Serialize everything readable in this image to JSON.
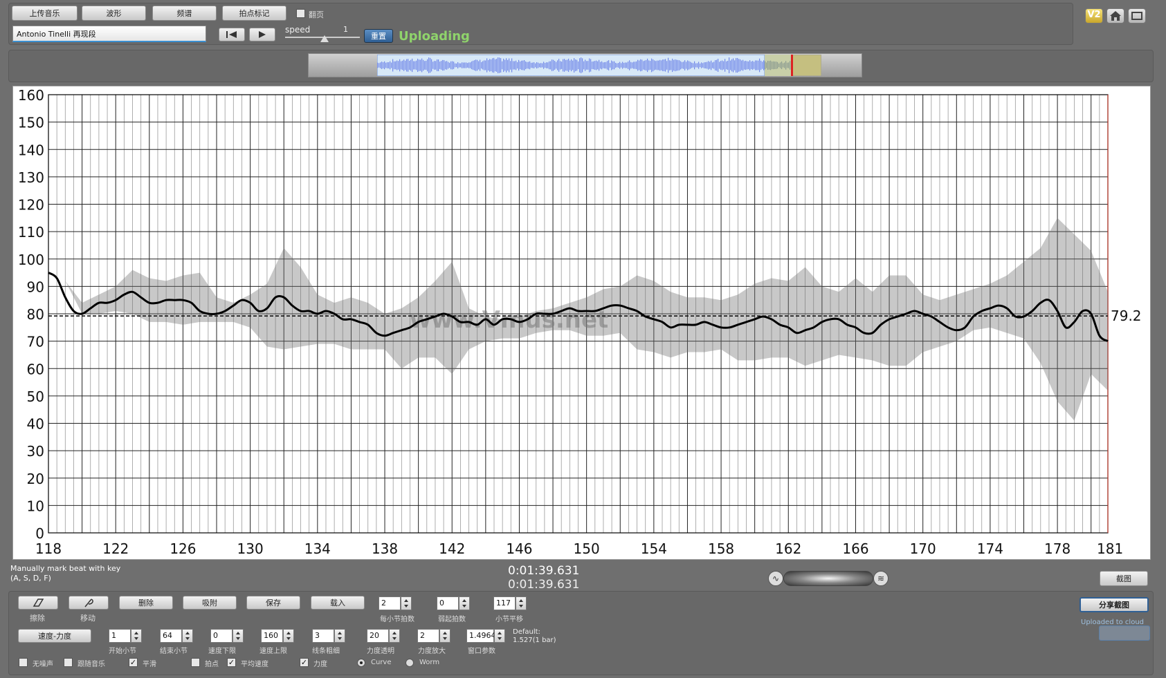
{
  "toolbar": {
    "upload_label": "上传音乐",
    "waveform_label": "波形",
    "spectrum_label": "频谱",
    "beat_mark_label": "拍点标记",
    "flip_label": "翻页",
    "track_name": "Antonio Tinelli 再现段",
    "speed_label": "speed",
    "speed_value": "1",
    "reset_label": "重置",
    "upload_status": "Uploading"
  },
  "top_right_icons": [
    "v2-icon",
    "home-icon",
    "window-icon"
  ],
  "top_right": {
    "v2_label": "V2"
  },
  "watermark": "www.Vmus.net",
  "status": {
    "hint_line1": "Manually mark beat with key",
    "hint_line2": "(A, S, D, F)",
    "time_1": "0:01:39.631",
    "time_2": "0:01:39.631",
    "screenshot_label": "截图"
  },
  "controls": {
    "erase_label": "擦除",
    "move_label": "移动",
    "delete_label": "删除",
    "snap_label": "吸附",
    "save_label": "保存",
    "load_label": "载入",
    "beats_per_bar_value": "2",
    "beats_per_bar_label": "每小节拍数",
    "start_beat_value": "0",
    "start_beat_label": "弱起拍数",
    "bar_shift_value": "117",
    "bar_shift_label": "小节平移",
    "mode_label": "速度-力度",
    "start_bar_value": "1",
    "start_bar_label": "开始小节",
    "end_bar_value": "64",
    "end_bar_label": "结束小节",
    "tempo_low_value": "0",
    "tempo_low_label": "速度下限",
    "tempo_high_value": "160",
    "tempo_high_label": "速度上限",
    "line_width_value": "3",
    "line_width_label": "线条粗细",
    "dyn_alpha_value": "20",
    "dyn_alpha_label": "力度透明",
    "dyn_zoom_value": "2",
    "dyn_zoom_label": "力度放大",
    "window_value": "1.4964",
    "window_label": "窗口参数",
    "default_line1": "Default:",
    "default_line2": "1.527(1 bar)",
    "share_label": "分享截图",
    "uploaded_label": "Uploaded to cloud",
    "cb_no_noise": "无噪声",
    "cb_follow_music": "跟随音乐",
    "cb_smooth": "平滑",
    "cb_beat": "拍点",
    "cb_avg_tempo": "平均速度",
    "cb_dynamics": "力度",
    "radio_curve": "Curve",
    "radio_worm": "Worm"
  },
  "chart_data": {
    "type": "line",
    "xlim": [
      118,
      181
    ],
    "ylim": [
      0,
      160
    ],
    "x_ticks": [
      118,
      122,
      126,
      130,
      134,
      138,
      142,
      146,
      150,
      154,
      158,
      162,
      166,
      170,
      174,
      178,
      181
    ],
    "y_ticks": [
      0,
      10,
      20,
      30,
      40,
      50,
      60,
      70,
      80,
      90,
      100,
      110,
      120,
      130,
      140,
      150,
      160
    ],
    "average": 79.2,
    "average_label": "79.2",
    "grid": true,
    "series": [
      {
        "x": [
          118,
          118.5,
          119,
          119.5,
          120,
          120.5,
          121,
          121.5,
          122,
          122.5,
          123,
          123.5,
          124,
          124.5,
          125,
          125.5,
          126,
          126.5,
          127,
          127.5,
          128,
          128.5,
          129,
          129.5,
          130,
          130.5,
          131,
          131.5,
          132,
          132.5,
          133,
          133.5,
          134,
          134.5,
          135,
          135.5,
          136,
          136.5,
          137,
          137.5,
          138,
          138.5,
          139,
          139.5,
          140,
          140.5,
          141,
          141.5,
          142,
          142.5,
          143,
          143.5,
          144,
          144.5,
          145,
          145.5,
          146,
          146.5,
          147,
          147.5,
          148,
          148.5,
          149,
          149.5,
          150,
          150.5,
          151,
          151.5,
          152,
          152.5,
          153,
          153.5,
          154,
          154.5,
          155,
          155.5,
          156,
          156.5,
          157,
          157.5,
          158,
          158.5,
          159,
          159.5,
          160,
          160.5,
          161,
          161.5,
          162,
          162.5,
          163,
          163.5,
          164,
          164.5,
          165,
          165.5,
          166,
          166.5,
          167,
          167.5,
          168,
          168.5,
          169,
          169.5,
          170,
          170.5,
          171,
          171.5,
          172,
          172.5,
          173,
          173.5,
          174,
          174.5,
          175,
          175.5,
          176,
          176.5,
          177,
          177.5,
          178,
          178.5,
          179,
          179.5,
          180,
          180.5,
          181
        ],
        "y": [
          95,
          93,
          86,
          81,
          80,
          82,
          84,
          84,
          85,
          87,
          88,
          86,
          84,
          84,
          85,
          85,
          85,
          84,
          81,
          80,
          80,
          81,
          83,
          85,
          84,
          81,
          82,
          86,
          86,
          83,
          81,
          81,
          80,
          81,
          80,
          78,
          78,
          77,
          76,
          73,
          72,
          73,
          74,
          75,
          77,
          78,
          79,
          80,
          79,
          77,
          77,
          76,
          78,
          76,
          78,
          78,
          77,
          78,
          80,
          80,
          80,
          81,
          82,
          81,
          81,
          81,
          82,
          83,
          83,
          82,
          81,
          79,
          78,
          77,
          75,
          76,
          76,
          76,
          77,
          76,
          75,
          75,
          76,
          77,
          78,
          79,
          78,
          76,
          75,
          73,
          74,
          75,
          77,
          78,
          78,
          76,
          75,
          73,
          73,
          76,
          78,
          79,
          80,
          81,
          80,
          79,
          77,
          75,
          74,
          75,
          79,
          81,
          82,
          83,
          82,
          79,
          79,
          81,
          84,
          85,
          81,
          75,
          77,
          81,
          80,
          72,
          70
        ]
      }
    ],
    "band": {
      "x": [
        118,
        119,
        120,
        121,
        122,
        123,
        124,
        125,
        126,
        127,
        128,
        129,
        130,
        131,
        132,
        133,
        134,
        135,
        136,
        137,
        138,
        139,
        140,
        141,
        142,
        143,
        144,
        145,
        146,
        147,
        148,
        149,
        150,
        151,
        152,
        153,
        154,
        155,
        156,
        157,
        158,
        159,
        160,
        161,
        162,
        163,
        164,
        165,
        166,
        167,
        168,
        169,
        170,
        171,
        172,
        173,
        174,
        175,
        176,
        177,
        178,
        179,
        180,
        181
      ],
      "upper": [
        95,
        92,
        84,
        87,
        90,
        96,
        93,
        92,
        94,
        95,
        86,
        84,
        87,
        91,
        104,
        97,
        87,
        84,
        86,
        84,
        80,
        82,
        86,
        92,
        99,
        82,
        79,
        78,
        79,
        81,
        82,
        84,
        86,
        89,
        90,
        94,
        92,
        88,
        86,
        86,
        85,
        87,
        91,
        93,
        92,
        97,
        90,
        88,
        93,
        88,
        94,
        94,
        87,
        85,
        87,
        89,
        91,
        94,
        99,
        104,
        115,
        109,
        103,
        88
      ],
      "lower": [
        95,
        92,
        80,
        80,
        81,
        80,
        77,
        77,
        76,
        77,
        77,
        77,
        75,
        68,
        67,
        68,
        69,
        69,
        67,
        67,
        67,
        60,
        64,
        64,
        58,
        67,
        70,
        71,
        71,
        73,
        74,
        74,
        72,
        72,
        73,
        67,
        66,
        64,
        66,
        66,
        67,
        63,
        63,
        64,
        64,
        61,
        63,
        65,
        64,
        63,
        61,
        61,
        66,
        68,
        70,
        74,
        75,
        73,
        71,
        62,
        48,
        41,
        58,
        52
      ]
    }
  }
}
